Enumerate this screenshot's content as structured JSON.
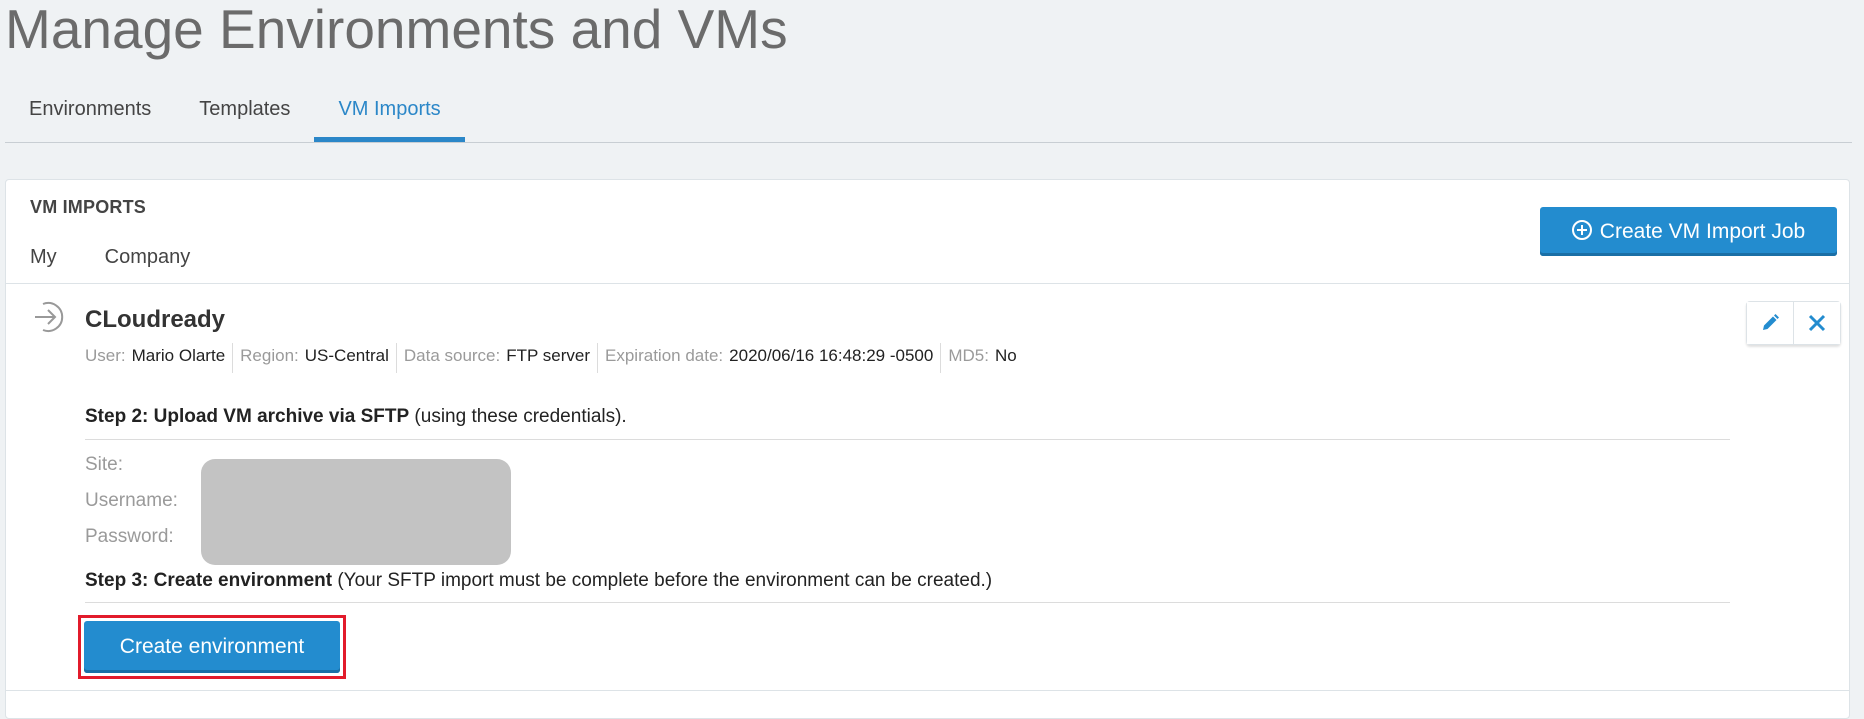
{
  "page": {
    "title": "Manage Environments and VMs"
  },
  "tabs": [
    {
      "label": "Environments",
      "active": false
    },
    {
      "label": "Templates",
      "active": false
    },
    {
      "label": "VM Imports",
      "active": true
    }
  ],
  "card": {
    "section_title": "VM IMPORTS",
    "subtabs": [
      {
        "label": "My"
      },
      {
        "label": "Company"
      }
    ],
    "create_button": {
      "label": "Create VM Import Job",
      "icon": "plus-circle-icon"
    }
  },
  "entry": {
    "title": "CLoudready",
    "icon": "import-arrow-icon",
    "meta": [
      {
        "label": "User:",
        "value": "Mario Olarte"
      },
      {
        "label": "Region:",
        "value": "US-Central"
      },
      {
        "label": "Data source:",
        "value": "FTP server"
      },
      {
        "label": "Expiration date:",
        "value": "2020/06/16 16:48:29 -0500"
      },
      {
        "label": "MD5:",
        "value": "No"
      }
    ],
    "actions": [
      {
        "icon": "pencil-icon"
      },
      {
        "icon": "close-icon"
      }
    ],
    "step2": {
      "bold": "Step 2: Upload VM archive via SFTP",
      "rest": " (using these credentials)."
    },
    "credentials": {
      "site_label": "Site:",
      "username_label": "Username:",
      "password_label": "Password:"
    },
    "step3": {
      "bold": "Step 3: Create environment",
      "rest": " (Your SFTP import must be complete before the environment can be created.)"
    },
    "create_env_button": "Create environment"
  },
  "colors": {
    "accent": "#238ccf",
    "highlight": "#e21b2b",
    "background": "#eff2f4"
  }
}
